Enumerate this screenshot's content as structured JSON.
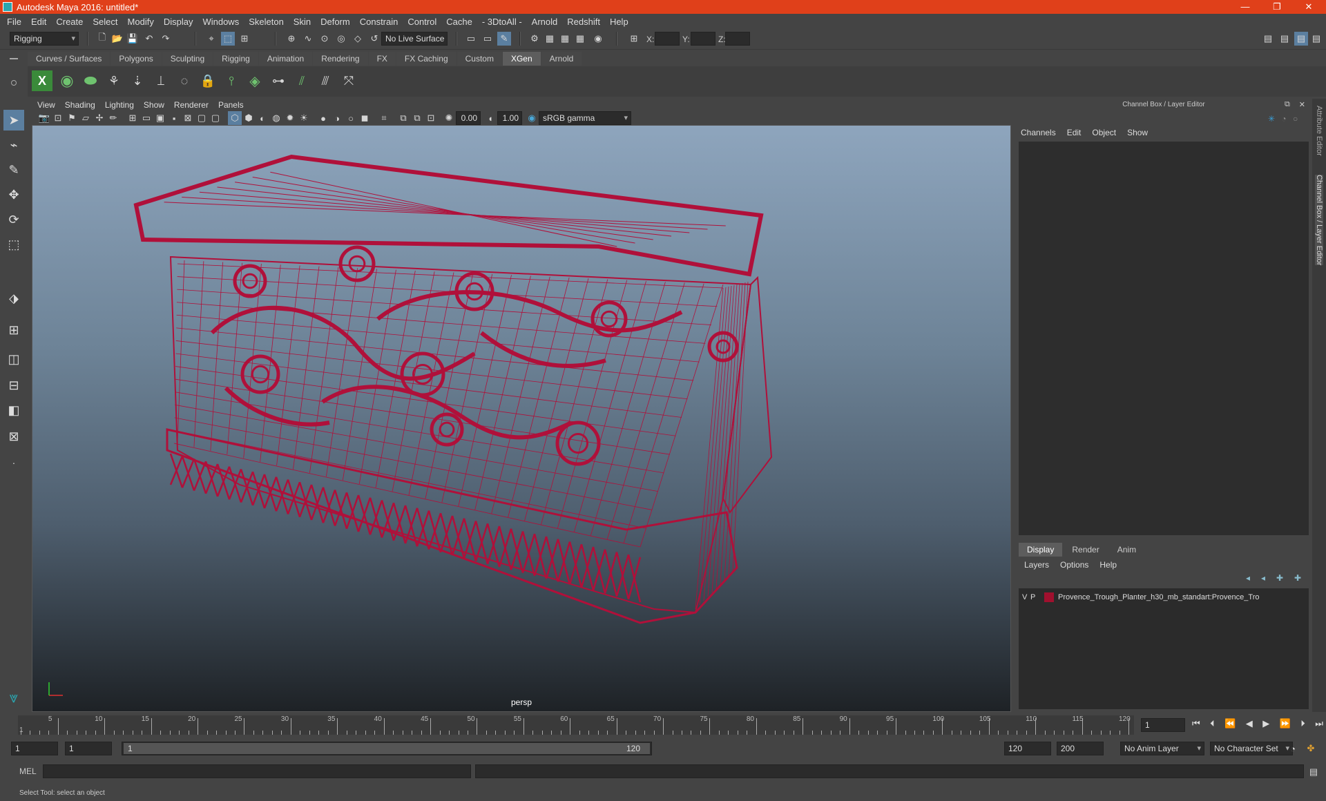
{
  "window": {
    "title": "Autodesk Maya 2016: untitled*",
    "minimize": "—",
    "restore": "❐",
    "close": "✕"
  },
  "menubar": [
    "File",
    "Edit",
    "Create",
    "Select",
    "Modify",
    "Display",
    "Windows",
    "Skeleton",
    "Skin",
    "Deform",
    "Constrain",
    "Control",
    "Cache",
    "- 3DtoAll -",
    "Arnold",
    "Redshift",
    "Help"
  ],
  "status": {
    "menuset": "Rigging",
    "live_surface": "No Live Surface",
    "x_label": "X:",
    "y_label": "Y:",
    "z_label": "Z:"
  },
  "shelf_tabs": [
    "Curves / Surfaces",
    "Polygons",
    "Sculpting",
    "Rigging",
    "Animation",
    "Rendering",
    "FX",
    "FX Caching",
    "Custom",
    "XGen",
    "Arnold"
  ],
  "shelf_active": "XGen",
  "viewport": {
    "menus": [
      "View",
      "Shading",
      "Lighting",
      "Show",
      "Renderer",
      "Panels"
    ],
    "exposure": "0.00",
    "gamma": "1.00",
    "colorspace": "sRGB gamma",
    "camera": "persp",
    "model_color": "#b0103a"
  },
  "channel_box": {
    "title": "Channel Box / Layer Editor",
    "menus": [
      "Channels",
      "Edit",
      "Object",
      "Show"
    ]
  },
  "layer_editor": {
    "tabs": [
      "Display",
      "Render",
      "Anim"
    ],
    "active_tab": "Display",
    "menus": [
      "Layers",
      "Options",
      "Help"
    ],
    "layer": {
      "v": "V",
      "p": "P",
      "name": "Provence_Trough_Planter_h30_mb_standart:Provence_Tro",
      "color": "#a0102e"
    }
  },
  "side_tabs": {
    "attribute_editor": "Attribute Editor",
    "channel_box": "Channel Box / Layer Editor"
  },
  "timeline": {
    "ticks": [
      "5",
      "10",
      "15",
      "20",
      "25",
      "30",
      "35",
      "40",
      "45",
      "50",
      "55",
      "60",
      "65",
      "70",
      "75",
      "80",
      "85",
      "90",
      "95",
      "100",
      "105",
      "110",
      "115",
      "120"
    ],
    "start_label": "1",
    "current_frame": "1"
  },
  "range": {
    "start": "1",
    "start2": "1",
    "range_start": "1",
    "range_end": "120",
    "end": "120",
    "end2": "200",
    "anim_layer": "No Anim Layer",
    "char_set": "No Character Set"
  },
  "command": {
    "label": "MEL"
  },
  "helpline": "Select Tool: select an object"
}
